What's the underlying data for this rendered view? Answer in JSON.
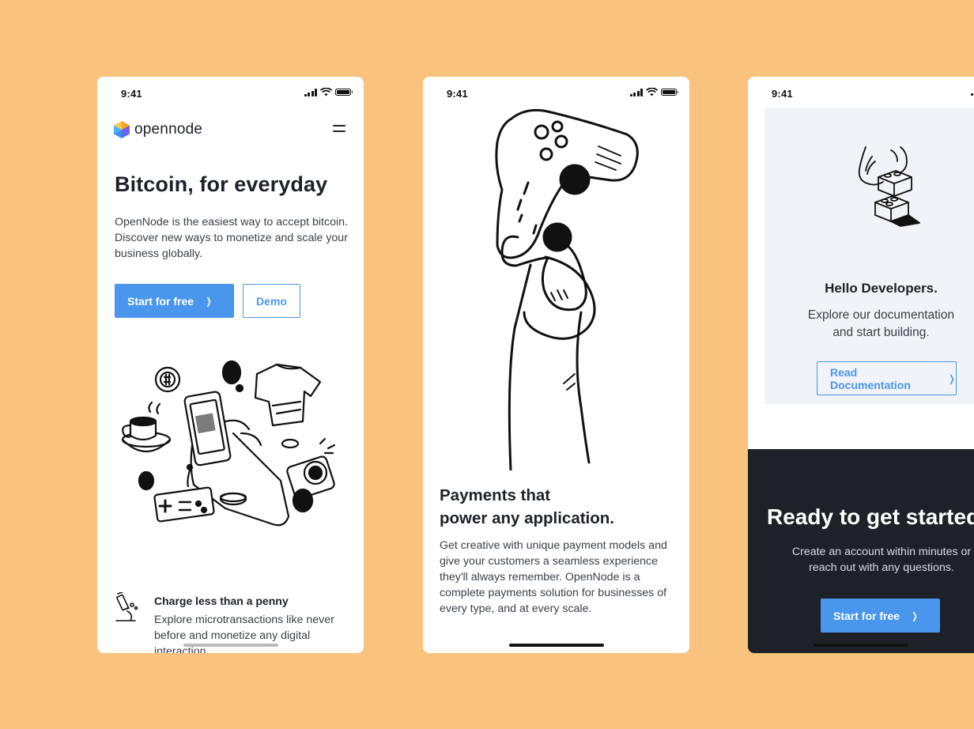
{
  "colors": {
    "background": "#f9c27d",
    "accent": "#4a96ed",
    "dark": "#1e2128",
    "panel": "#f0f3f7"
  },
  "screens": [
    {
      "status": {
        "time": "9:41"
      },
      "brand": {
        "name": "opennode",
        "logo_icon": "opennode-hexagon-logo"
      },
      "menu_icon": "hamburger-menu-icon",
      "hero": {
        "title": "Bitcoin, for everyday",
        "description": "OpenNode is the easiest way to accept bitcoin. Discover new ways to monetize and scale your business globally.",
        "primary_label": "Start for free",
        "secondary_label": "Demo"
      },
      "illustration": "hand-holding-phone-with-coins-camera-controller-illustration",
      "feature": {
        "icon": "microscope-icon",
        "title": "Charge less than a penny",
        "description": "Explore microtransactions like never before and monetize any digital interaction"
      }
    },
    {
      "status": {
        "time": "9:41"
      },
      "illustration": "hand-holding-game-controller-illustration",
      "title_line1": "Payments that",
      "title_line2": "power any application.",
      "description": "Get creative with unique payment models and give your customers a seamless experience they'll always remember. OpenNode is a complete payments solution for businesses of every type, and at every scale."
    },
    {
      "status": {
        "time": "9:41"
      },
      "developers": {
        "illustration": "hands-stacking-blocks-illustration",
        "title": "Hello Developers.",
        "description_line1": "Explore our documentation",
        "description_line2": "and start building.",
        "button_label": "Read Documentation"
      },
      "cta": {
        "title": "Ready to get started?",
        "description_line1": "Create an account within minutes or",
        "description_line2": "reach out with any questions.",
        "button_label": "Start for free"
      }
    }
  ]
}
